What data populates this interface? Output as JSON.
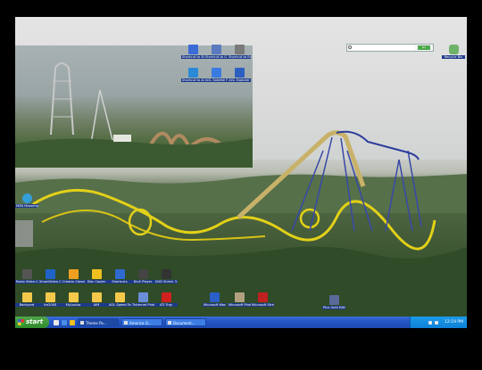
{
  "search": {
    "placeholder": "",
    "button_label": "Go"
  },
  "top_icons": [
    {
      "label": "Shortcut to Studio Media",
      "color": "#3a6bd6"
    },
    {
      "label": "Shortcut to G Stick Pro",
      "color": "#5a7ac0"
    },
    {
      "label": "Shortcut to Email Fe.",
      "color": "#7a7a7a"
    },
    {
      "label": "Shortcut to AOL Photo Area",
      "color": "#2a8ad6"
    },
    {
      "label": "AOL Satelite Picture",
      "color": "#3b7be0"
    },
    {
      "label": "AOL Explorer",
      "color": "#2d5fc2"
    }
  ],
  "recycle_bin": {
    "label": "Recycle Bin",
    "color": "#6fb26a"
  },
  "left_icon": {
    "label": "MSN Messenger",
    "color": "#33a0d8"
  },
  "bottom_row1": [
    {
      "label": "Roxio Video Capture",
      "color": "#555"
    },
    {
      "label": "SmartVideo CREATE",
      "color": "#1f63c8"
    },
    {
      "label": "Creator Classic",
      "color": "#f0a020"
    },
    {
      "label": "Disc Copier",
      "color": "#f0c020"
    },
    {
      "label": "Shortcuts",
      "color": "#2f6ad0"
    },
    {
      "label": "DivX Player",
      "color": "#444"
    },
    {
      "label": "DVD Shrink 3.2",
      "color": "#333"
    }
  ],
  "bottom_row2": [
    {
      "label": "Backyard",
      "color": "#f4c84a"
    },
    {
      "label": "Ice2000",
      "color": "#f4c84a"
    },
    {
      "label": "MyLouisa",
      "color": "#f4c84a"
    },
    {
      "label": "AIM",
      "color": "#f4c84a"
    },
    {
      "label": "AOL Speed Test",
      "color": "#f4c84a"
    },
    {
      "label": "Tinternet Photo Tools",
      "color": "#6a8ed8"
    },
    {
      "label": "ATI Tray",
      "color": "#d02020"
    },
    {
      "label": "Microsoft Word",
      "color": "#2b5fc8"
    },
    {
      "label": "Microsoft Photo Story",
      "color": "#b0a080"
    },
    {
      "label": "Microsoft Streets",
      "color": "#c02020"
    },
    {
      "label": "Plus Gold Edition",
      "color": "#5a6a9a"
    }
  ],
  "taskbar": {
    "start_label": "start",
    "tasks": [
      {
        "label": "Theme Pa...",
        "active": true
      },
      {
        "label": "America O...",
        "active": false
      },
      {
        "label": "Document...",
        "active": false
      }
    ],
    "clock": "12:19 PM"
  }
}
